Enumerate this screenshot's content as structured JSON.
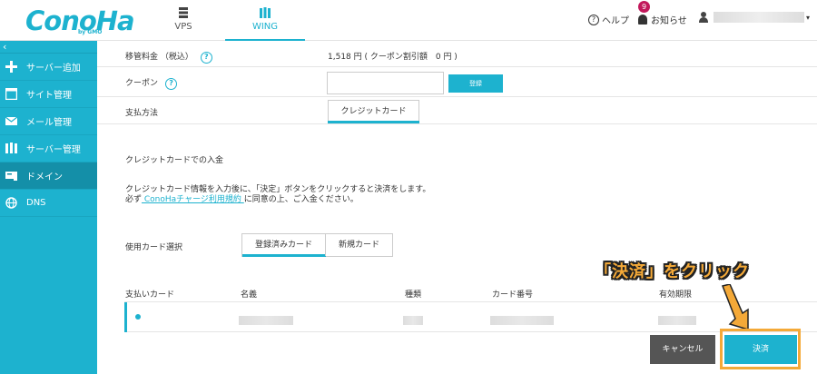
{
  "brand": {
    "logo": "ConoHa",
    "logo_sub": "by GMO"
  },
  "topnav": {
    "vps": "VPS",
    "wing": "WING"
  },
  "header": {
    "help": "ヘルプ",
    "notice": "お知らせ",
    "notice_count": "9"
  },
  "sidebar": {
    "collapse": "‹",
    "items": [
      {
        "label": "サーバー追加",
        "icon": "plus-icon"
      },
      {
        "label": "サイト管理",
        "icon": "window-icon"
      },
      {
        "label": "メール管理",
        "icon": "mail-icon"
      },
      {
        "label": "サーバー管理",
        "icon": "server-icon"
      },
      {
        "label": "ドメイン",
        "icon": "domain-icon"
      },
      {
        "label": "DNS",
        "icon": "globe-icon"
      }
    ]
  },
  "form": {
    "transfer_fee_label": "移管料金 （税込）",
    "transfer_fee_value": "1,518 円 ( クーポン割引額　0 円 )",
    "coupon_label": "クーポン",
    "coupon_placeholder": "",
    "coupon_button": "登録",
    "payment_method_label": "支払方法",
    "payment_method_tab": "クレジットカード"
  },
  "deposit": {
    "title": "クレジットカードでの入金",
    "desc1": "クレジットカード情報を入力後に、「決定」ボタンをクリックすると決済をします。",
    "desc2_prefix": "必ず",
    "desc2_link": " ConoHaチャージ利用規約 ",
    "desc2_suffix": "に同意の上、ご入金ください。"
  },
  "card_select": {
    "label": "使用カード選択",
    "tabs": [
      "登録済みカード",
      "新規カード"
    ]
  },
  "table": {
    "headers": [
      "支払いカード",
      "名義",
      "種類",
      "カード番号",
      "有効期限"
    ]
  },
  "actions": {
    "cancel": "キャンセル",
    "pay": "決済"
  },
  "annotation": "「決済」をクリック",
  "colors": {
    "accent": "#1db2cf",
    "highlight": "#f4a938",
    "badge": "#c2185b"
  }
}
